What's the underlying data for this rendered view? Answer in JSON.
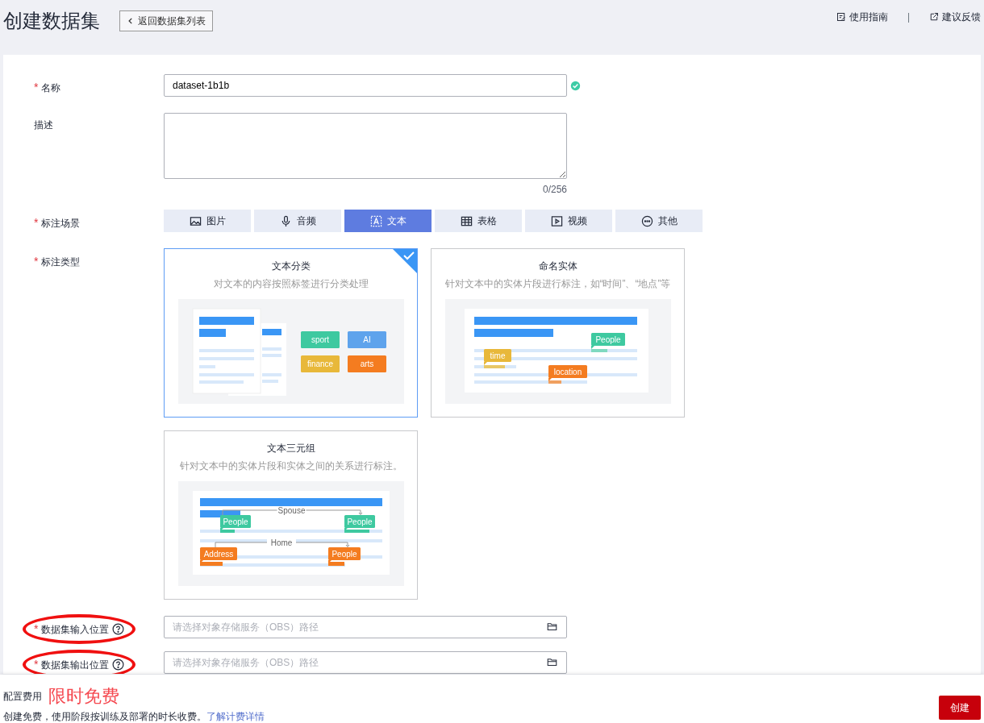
{
  "page": {
    "title": "创建数据集",
    "back_button": "返回数据集列表",
    "links": [
      {
        "label": "使用指南",
        "kind": "guide"
      },
      {
        "label": "建议反馈",
        "kind": "feedback"
      }
    ],
    "separator": "|"
  },
  "form": {
    "required_mark": "*",
    "name": {
      "label": "名称",
      "required": true,
      "value": "dataset-1b1b",
      "valid": true
    },
    "description": {
      "label": "描述",
      "required": false,
      "count": "0/256"
    },
    "scene": {
      "label": "标注场景",
      "required": true,
      "options": [
        {
          "label": "图片",
          "kind": "image",
          "selected": false
        },
        {
          "label": "音频",
          "kind": "audio",
          "selected": false
        },
        {
          "label": "文本",
          "kind": "text",
          "selected": true
        },
        {
          "label": "表格",
          "kind": "table",
          "selected": false
        },
        {
          "label": "视频",
          "kind": "video",
          "selected": false
        },
        {
          "label": "其他",
          "kind": "other",
          "selected": false
        }
      ]
    },
    "type": {
      "label": "标注类型",
      "required": true,
      "options": [
        {
          "title": "文本分类",
          "description": "对文本的内容按照标签进行分类处理",
          "kind": "classification",
          "selected": true,
          "tags": [
            "sport",
            "AI",
            "finance",
            "arts"
          ]
        },
        {
          "title": "命名实体",
          "description": "针对文本中的实体片段进行标注，如“时间”、“地点”等",
          "kind": "entity",
          "selected": false,
          "tags": [
            "People",
            "time",
            "location"
          ]
        },
        {
          "title": "文本三元组",
          "description": "针对文本中的实体片段和实体之间的关系进行标注。",
          "kind": "triple",
          "selected": false,
          "tags": [
            "Spouse",
            "People",
            "People",
            "Home",
            "Address",
            "People"
          ]
        }
      ]
    },
    "input_location": {
      "label": "数据集输入位置",
      "required": true,
      "placeholder": "请选择对象存储服务（OBS）路径",
      "highlighted": true
    },
    "output_location": {
      "label": "数据集输出位置",
      "required": true,
      "placeholder": "请选择对象存储服务（OBS）路径",
      "highlighted": true
    }
  },
  "footer": {
    "label": "配置费用",
    "price": "限时免费",
    "note": "创建免费，使用阶段按训练及部署的时长收费。",
    "link": "了解计费详情",
    "button": "创建"
  }
}
